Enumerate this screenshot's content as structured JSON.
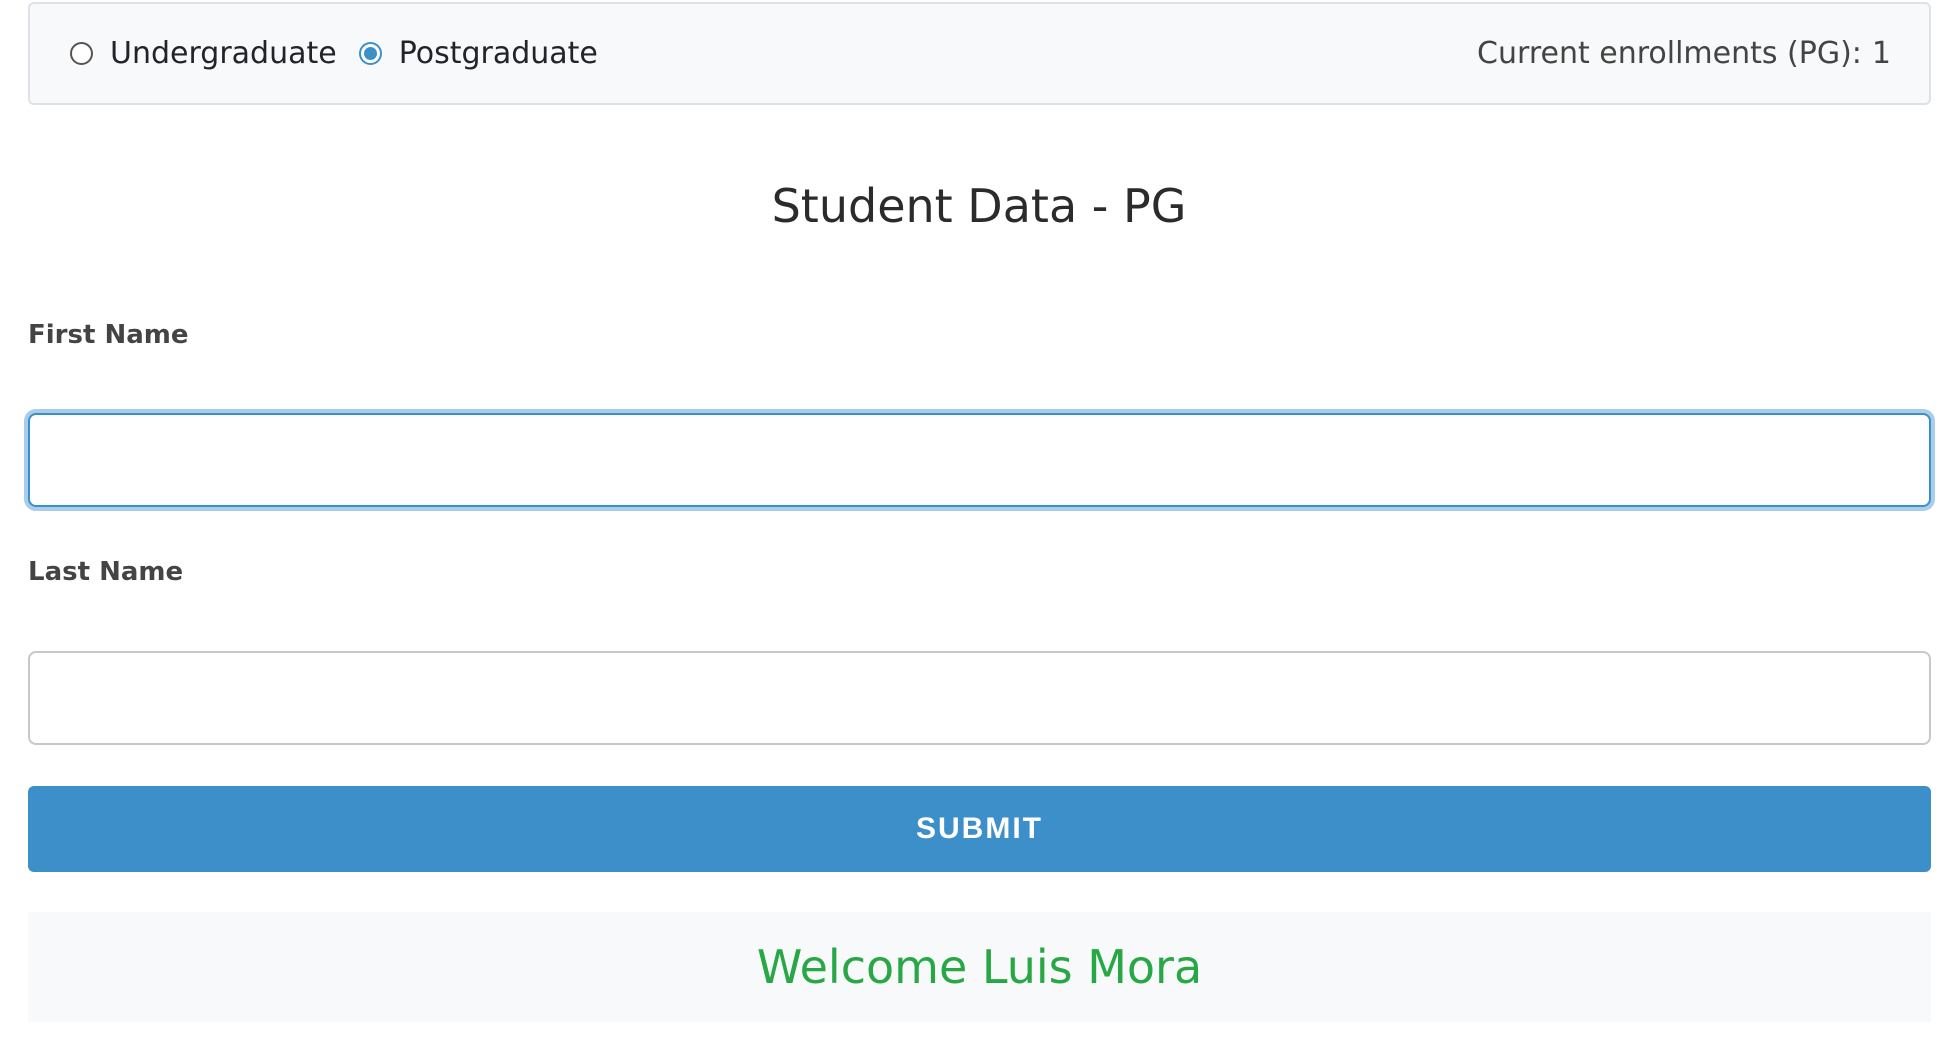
{
  "program_selector": {
    "options": [
      {
        "label": "Undergraduate",
        "checked": false
      },
      {
        "label": "Postgraduate",
        "checked": true
      }
    ]
  },
  "enrollment": {
    "label": "Current enrollments (PG):",
    "count": "1"
  },
  "form": {
    "title": "Student Data - PG",
    "first_name_label": "First Name",
    "first_name_value": "",
    "last_name_label": "Last Name",
    "last_name_value": "",
    "submit_label": "SUBMIT"
  },
  "welcome": {
    "message": "Welcome Luis Mora"
  },
  "colors": {
    "accent": "#3d8fca",
    "success": "#28a745"
  }
}
